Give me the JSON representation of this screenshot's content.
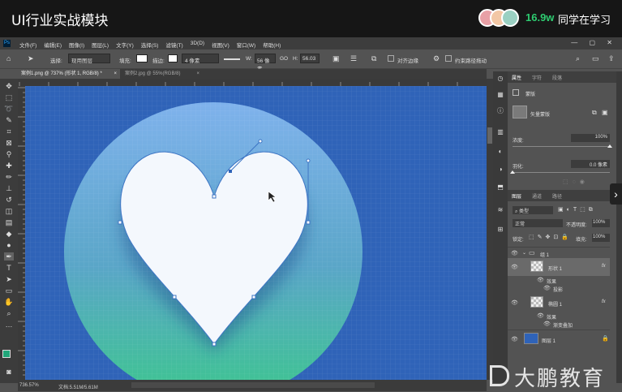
{
  "course_header": {
    "title": "UI行业实战模块",
    "viewer_count": "16.9w",
    "viewer_label": "同学在学习"
  },
  "menubar": {
    "app_icon": "Ps",
    "items": [
      "文件(F)",
      "编辑(E)",
      "图像(I)",
      "图层(L)",
      "文字(Y)",
      "选择(S)",
      "滤镜(T)",
      "3D(D)",
      "视图(V)",
      "窗口(W)",
      "帮助(H)"
    ],
    "window_controls": "— ▢ ✕"
  },
  "options_bar": {
    "select_label": "选择:",
    "select_value": "现用图层",
    "fill_label": "填充:",
    "stroke_label": "描边:",
    "stroke_size": "4 像素",
    "w_label": "W:",
    "w_value": "56 像素",
    "go_label": "GO",
    "h_label": "H:",
    "h_value": "56.03",
    "align_edges": "对齐边缘",
    "constrain_path": "约束路径拖动"
  },
  "doc_tabs": [
    {
      "label": "案例1.png @ 737% (形状 1, RGB/8) *",
      "close": "×"
    },
    {
      "label": "案例2.jpg @ 55%(RGB/8)",
      "close": "×"
    }
  ],
  "status_bar": {
    "zoom": "736.57%",
    "doc_info": "文档:5.51M/5.61M"
  },
  "properties_panel": {
    "tabs": [
      "属性",
      "字符",
      "段落"
    ],
    "mask_label": "蒙版",
    "vector_mask_label": "矢量蒙版",
    "density_label": "浓度:",
    "density_value": "100%",
    "feather_label": "羽化:",
    "feather_value": "0.0 像素",
    "density_level": 1.0,
    "feather_level": 0.0
  },
  "layers_panel": {
    "tabs": [
      "图层",
      "通道",
      "路径"
    ],
    "filter_label": "类型",
    "blend_mode": "正常",
    "opacity_label": "不透明度:",
    "opacity_value": "100%",
    "lock_label": "锁定:",
    "fill_label": "填充:",
    "fill_value": "100%",
    "layers": [
      {
        "name": "组 1",
        "kind": "group"
      },
      {
        "name": "形状 1",
        "kind": "shape",
        "fx": "fx"
      },
      {
        "name": "效果",
        "kind": "effect-header"
      },
      {
        "name": "投影",
        "kind": "effect"
      },
      {
        "name": "椭圆 1",
        "kind": "shape",
        "fx": "fx"
      },
      {
        "name": "效果",
        "kind": "effect-header"
      },
      {
        "name": "渐变叠加",
        "kind": "effect"
      },
      {
        "name": "图层 1",
        "kind": "pixel"
      }
    ]
  },
  "watermark": {
    "text": "大鹏教育"
  },
  "colors": {
    "canvas_bg": "#2f63b8",
    "circle_top": "#7fb2ec",
    "circle_bottom": "#3cc68e",
    "heart": "#f4f8fd",
    "viewer_accent": "#2ecc71",
    "foreground_swatch": "#21a77a"
  }
}
